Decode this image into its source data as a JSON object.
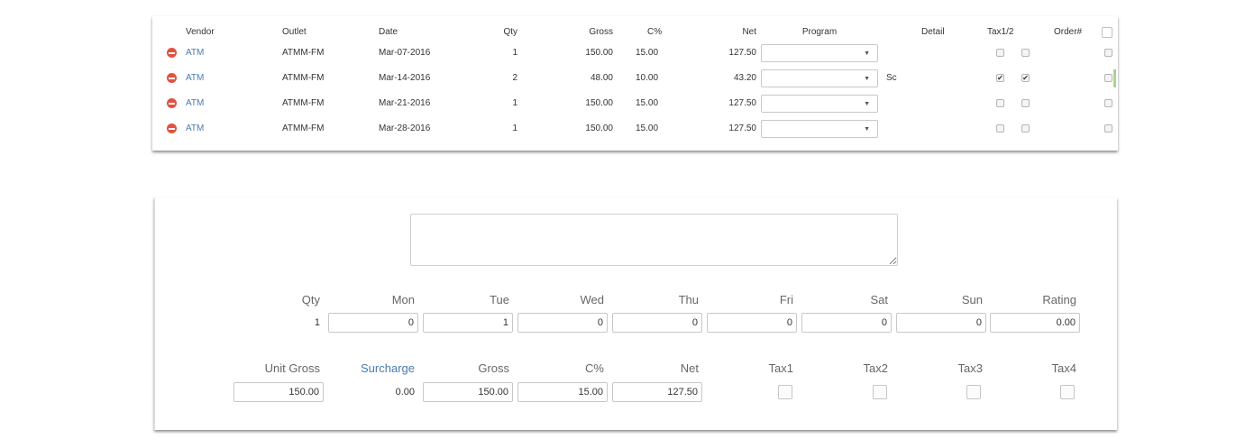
{
  "table": {
    "headers": {
      "vendor": "Vendor",
      "outlet": "Outlet",
      "date": "Date",
      "qty": "Qty",
      "gross": "Gross",
      "cpct": "C%",
      "net": "Net",
      "program": "Program",
      "detail": "Detail",
      "tax": "Tax1/2",
      "order": "Order#"
    },
    "rows": [
      {
        "vendor": "ATM",
        "outlet": "ATMM-FM",
        "date": "Mar-07-2016",
        "qty": "1",
        "gross": "150.00",
        "cpct": "15.00",
        "net": "127.50",
        "program": "",
        "detail": "",
        "tax1": false,
        "tax2": false
      },
      {
        "vendor": "ATM",
        "outlet": "ATMM-FM",
        "date": "Mar-14-2016",
        "qty": "2",
        "gross": "48.00",
        "cpct": "10.00",
        "net": "43.20",
        "program": "",
        "detail": "Sc",
        "tax1": true,
        "tax2": true
      },
      {
        "vendor": "ATM",
        "outlet": "ATMM-FM",
        "date": "Mar-21-2016",
        "qty": "1",
        "gross": "150.00",
        "cpct": "15.00",
        "net": "127.50",
        "program": "",
        "detail": "",
        "tax1": false,
        "tax2": false
      },
      {
        "vendor": "ATM",
        "outlet": "ATMM-FM",
        "date": "Mar-28-2016",
        "qty": "1",
        "gross": "150.00",
        "cpct": "15.00",
        "net": "127.50",
        "program": "",
        "detail": "",
        "tax1": false,
        "tax2": false
      }
    ]
  },
  "form": {
    "notes": "",
    "row1": {
      "labels": [
        "Qty",
        "Mon",
        "Tue",
        "Wed",
        "Thu",
        "Fri",
        "Sat",
        "Sun",
        "Rating"
      ],
      "qty_value": "1",
      "values": [
        "0",
        "1",
        "0",
        "0",
        "0",
        "0",
        "0",
        "0.00"
      ]
    },
    "row2": {
      "labels": [
        "Unit Gross",
        "Surcharge",
        "Gross",
        "C%",
        "Net",
        "Tax1",
        "Tax2",
        "Tax3",
        "Tax4"
      ],
      "unit_gross": "150.00",
      "surcharge": "0.00",
      "gross": "150.00",
      "cpct": "15.00",
      "net": "127.50"
    }
  }
}
